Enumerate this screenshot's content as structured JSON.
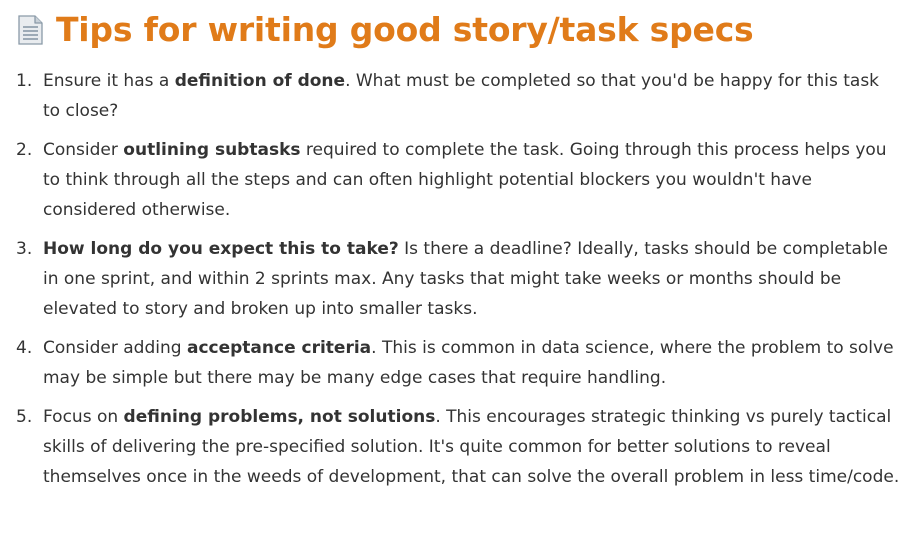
{
  "title": {
    "icon": "page-document-icon",
    "text": "Tips for writing good story/task specs",
    "color": "#e07b19"
  },
  "tips": [
    {
      "number": "1.",
      "pre": "Ensure it has a ",
      "bold": "definition of done",
      "post": ". What must be completed so that you'd be happy for this task to close?"
    },
    {
      "number": "2.",
      "pre": "Consider ",
      "bold": "outlining subtasks",
      "post": " required to complete the task. Going through this process helps you to think through all the steps and can often highlight potential blockers you wouldn't have considered otherwise."
    },
    {
      "number": "3.",
      "pre": "",
      "bold": "How long do you expect this to take?",
      "post": " Is there a deadline? Ideally, tasks should be completable in one sprint, and within 2 sprints max. Any tasks that might take weeks or months should be elevated to story and broken up into smaller tasks."
    },
    {
      "number": "4.",
      "pre": "Consider adding ",
      "bold": "acceptance criteria",
      "post": ". This is common in data science, where the problem to solve may be simple but there may be many edge cases that require handling."
    },
    {
      "number": "5.",
      "pre": "Focus on ",
      "bold": "defining problems, not solutions",
      "post": ". This encourages strategic thinking vs purely tactical skills of delivering the pre-specified solution. It's quite common for better solutions to reveal themselves once in the weeds of development, that can solve the overall problem in less time/code."
    }
  ]
}
